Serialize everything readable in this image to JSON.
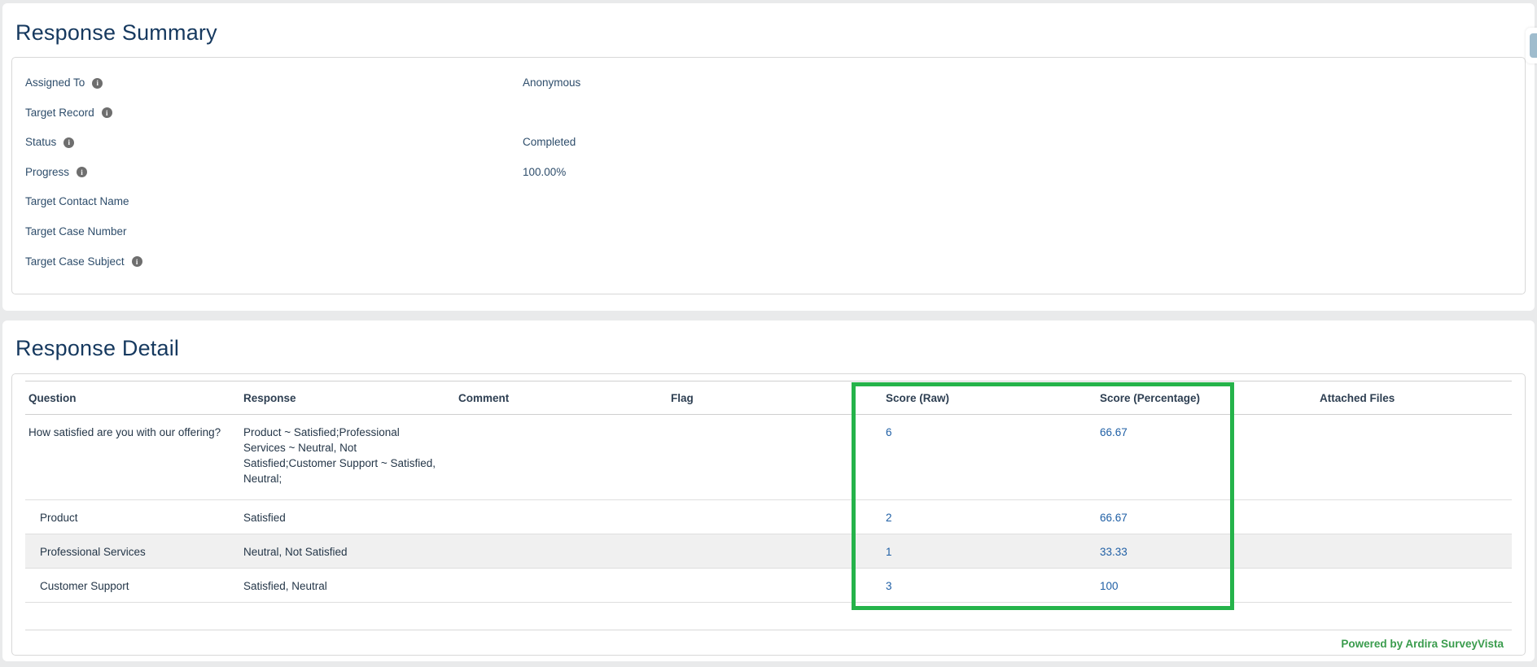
{
  "summary": {
    "title": "Response Summary",
    "fields": [
      {
        "label": "Assigned To",
        "info": true,
        "value": "Anonymous"
      },
      {
        "label": "Target Record",
        "info": true,
        "value": ""
      },
      {
        "label": "Status",
        "info": true,
        "value": "Completed"
      },
      {
        "label": "Progress",
        "info": true,
        "value": "100.00%"
      },
      {
        "label": "Target Contact Name",
        "info": false,
        "value": ""
      },
      {
        "label": "Target Case Number",
        "info": false,
        "value": ""
      },
      {
        "label": "Target Case Subject",
        "info": true,
        "value": ""
      }
    ],
    "info_icon_glyph": "i"
  },
  "detail": {
    "title": "Response Detail",
    "columns": [
      "Question",
      "Response",
      "Comment",
      "Flag",
      "Score (Raw)",
      "Score (Percentage)",
      "Attached Files"
    ],
    "rows": [
      {
        "question": "How satisfied are you with our offering?",
        "response": "Product ~ Satisfied;Professional Services ~ Neutral, Not Satisfied;Customer Support ~ Satisfied, Neutral;",
        "comment": "",
        "flag": "",
        "score_raw": "6",
        "score_pct": "66.67",
        "attached": "",
        "indent": false,
        "shaded": false
      },
      {
        "question": "Product",
        "response": "Satisfied",
        "comment": "",
        "flag": "",
        "score_raw": "2",
        "score_pct": "66.67",
        "attached": "",
        "indent": true,
        "shaded": false
      },
      {
        "question": "Professional Services",
        "response": "Neutral, Not Satisfied",
        "comment": "",
        "flag": "",
        "score_raw": "1",
        "score_pct": "33.33",
        "attached": "",
        "indent": true,
        "shaded": true
      },
      {
        "question": "Customer Support",
        "response": "Satisfied, Neutral",
        "comment": "",
        "flag": "",
        "score_raw": "3",
        "score_pct": "100",
        "attached": "",
        "indent": true,
        "shaded": false
      }
    ],
    "footer": "Powered by Ardira SurveyVista"
  },
  "colors": {
    "heading": "#16395f",
    "score_value": "#1f5fa5",
    "highlight_green": "#25b34a",
    "footer_green": "#3a9c4d",
    "shaded_row": "#f0f0f0",
    "page_background": "#e9eaeb"
  }
}
